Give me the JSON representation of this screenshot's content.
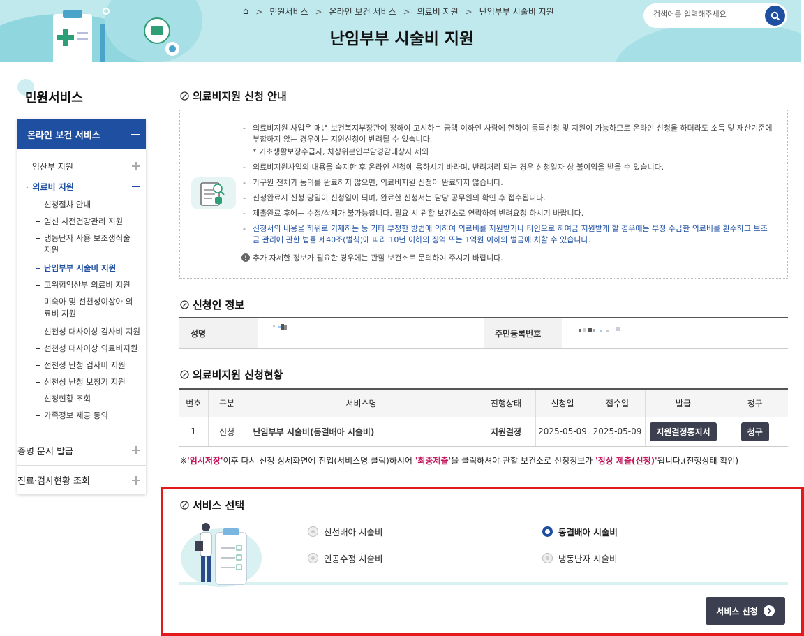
{
  "breadcrumb": {
    "home_icon": "home-icon",
    "items": [
      "민원서비스",
      "온라인 보건 서비스",
      "의료비 지원",
      "난임부부 시술비 지원"
    ]
  },
  "page_title": "난임부부 시술비 지원",
  "search": {
    "placeholder": "검색어를 입력해주세요"
  },
  "sidebar": {
    "title": "민원서비스",
    "active_section": "온라인 보건 서비스",
    "level2": [
      "임산부 지원",
      "의료비 지원"
    ],
    "level3": [
      "신청절차 안내",
      "임신 사전건강관리 지원",
      "냉동난자 사용 보조생식술 지원",
      "난임부부 시술비 지원",
      "고위험임산부 의료비 지원",
      "미숙아 및 선천성이상아 의료비 지원",
      "선천성 대사이상 검사비 지원",
      "선천성 대사이상 의료비지원",
      "선천성 난청 검사비 지원",
      "선천성 난청 보청기 지원",
      "신청현황 조회",
      "가족정보 제공 동의"
    ],
    "bottom": [
      "증명 문서 발급",
      "진료·검사현황 조회"
    ]
  },
  "guide": {
    "title": "의료비지원 신청 안내",
    "items": [
      "의료비지원 사업은 매년 보건복지부장관이 정하여 고시하는 금액 이하인 사람에 한하여 등록신청 및 지원이 가능하므로 온라인 신청을 하더라도 소득 및 재산기준에 부합하지 않는 경우에는 지원신청이 반려될 수 있습니다.",
      "의료비지원사업의 내용을 숙지한 후 온라인 신청에 응하시기 바라며, 반려처리 되는 경우 신청일자 상 불이익을 받을 수 있습니다.",
      "가구원 전체가 동의를 완료하지 않으면, 의료비지원 신청이 완료되지 않습니다.",
      "신청완료시 신청 당일이 신청일이 되며, 완료한 신청서는 담당 공무원의 확인 후 접수됩니다.",
      "제출완료 후에는 수정/삭제가 불가능합니다. 필요 시 관할 보건소로 연락하여 반려요청 하시기 바랍니다.",
      "신청서의 내용을 허위로 기재하는 등 기타 부정한 방법에 의하여 의료비를 지원받거나 타인으로 하여금 지원받게 할 경우에는 부정 수급한 의료비를 환수하고 보조금 관리에 관한 법률 제40조(벌칙)에 따라 10년 이하의 징역 또는 1억원 이하의 벌금에 처할 수 있습니다."
    ],
    "sub_note": "* 기초생활보장수급자, 차상위본인부담경감대상자 제외",
    "note": "추가 자세한 정보가 필요한 경우에는 관할 보건소로 문의하여 주시기 바랍니다."
  },
  "applicant": {
    "title": "신청인 정보",
    "name_label": "성명",
    "rrn_label": "주민등록번호"
  },
  "status": {
    "title": "의료비지원 신청현황",
    "headers": [
      "번호",
      "구분",
      "서비스명",
      "진행상태",
      "신청일",
      "접수일",
      "발급",
      "청구"
    ],
    "rows": [
      {
        "no": "1",
        "type": "신청",
        "service": "난임부부 시술비(동결배아 시술비)",
        "state": "지원결정",
        "applied": "2025-05-09",
        "received": "2025-05-09",
        "issue_btn": "지원결정통지서",
        "claim_btn": "청구"
      }
    ]
  },
  "footnote": {
    "prefix": "※",
    "q1": "'임시저장'",
    "t1": "이후 다시 신청 상세화면에 진입(서비스명 클릭)하시어 ",
    "q2": "'최종제출'",
    "t2": "을 클릭하셔야 관할 보건소로 신청정보가 ",
    "q3": "'정상 제출(신청)'",
    "t3": "됩니다.(진행상태 확인)"
  },
  "service_select": {
    "title": "서비스 선택",
    "options": [
      "신선배아 시술비",
      "동결배아 시술비",
      "인공수정 시술비",
      "냉동난자 시술비"
    ],
    "selected": "동결배아 시술비",
    "submit": "서비스 신청"
  },
  "colors": {
    "primary": "#1f4fa1",
    "accent": "#c2175c",
    "banner": "#bfe9ed",
    "dark_button": "#3b3f4f",
    "highlight_border": "#e3191c"
  }
}
